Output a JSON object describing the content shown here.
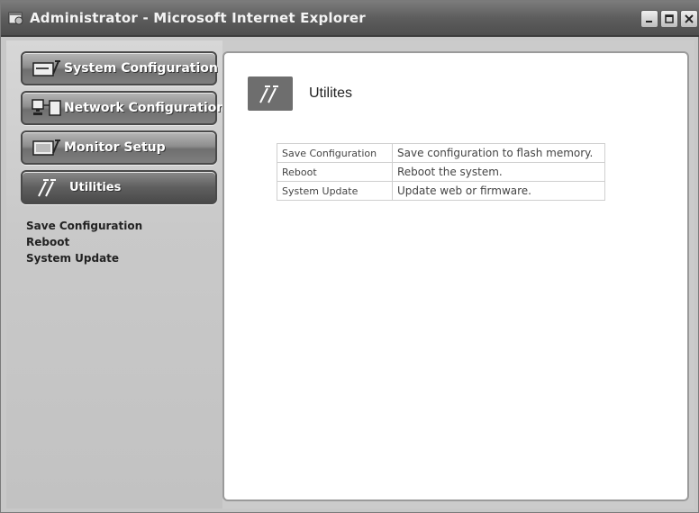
{
  "window": {
    "title": "Administrator - Microsoft Internet Explorer",
    "buttons": [
      "minimize-icon",
      "maximize-icon",
      "close-icon"
    ]
  },
  "sidebar": {
    "nav": [
      {
        "label": "System Configuration",
        "icon": "system-config-icon",
        "active": false
      },
      {
        "label": "Network Configuration",
        "icon": "network-config-icon",
        "active": false
      },
      {
        "label": "Monitor Setup",
        "icon": "monitor-setup-icon",
        "active": false
      },
      {
        "label": "Utilities",
        "icon": "utilities-icon",
        "active": true
      }
    ],
    "submenu": [
      "Save Configuration",
      "Reboot",
      "System Update"
    ]
  },
  "main": {
    "title": "Utilites",
    "icon": "utilities-icon",
    "table": [
      {
        "name": "Save Configuration",
        "description": "Save configuration to flash memory."
      },
      {
        "name": "Reboot",
        "description": "Reboot the system."
      },
      {
        "name": "System Update",
        "description": "Update web or firmware."
      }
    ]
  },
  "colors": {
    "titlebar": "#5d5d5d",
    "nav_button": "#8e8e8e",
    "content_bg": "#ffffff"
  }
}
